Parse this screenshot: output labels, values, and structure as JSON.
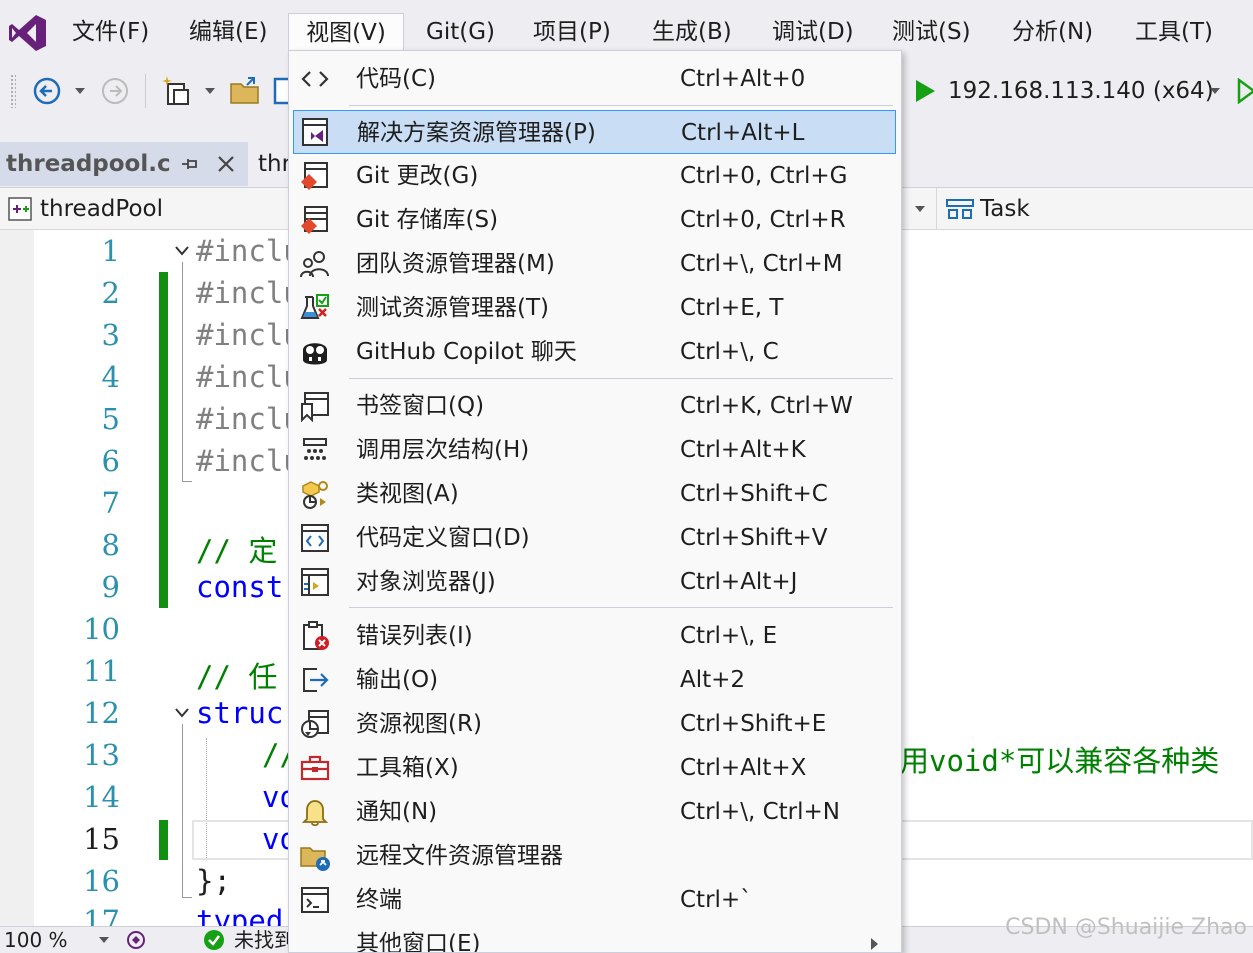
{
  "menubar": {
    "items": [
      "文件(F)",
      "编辑(E)",
      "视图(V)",
      "Git(G)",
      "项目(P)",
      "生成(B)",
      "调试(D)",
      "测试(S)",
      "分析(N)",
      "工具(T)"
    ]
  },
  "toolbar": {
    "debug_target": "192.168.113.140 (x64)"
  },
  "tabs": {
    "active": "threadpool.c",
    "second": "thr"
  },
  "navbar": {
    "scope": "threadPool",
    "member": "Task"
  },
  "editor": {
    "line_numbers": [
      "1",
      "2",
      "3",
      "4",
      "5",
      "6",
      "7",
      "8",
      "9",
      "10",
      "11",
      "12",
      "13",
      "14",
      "15",
      "16",
      "17"
    ],
    "lines": {
      "l1": "#inclu",
      "l2": "#inclu",
      "l3": "#inclu",
      "l4": "#inclu",
      "l5": "#inclu",
      "l6": "#inclu",
      "l8": "// 定",
      "l9": "const",
      "l11": "// 任",
      "l12": "struc",
      "l13": "//",
      "l13_right": "用void*可以兼容各种类",
      "l14": "vo",
      "l15": "vo",
      "l16": "};",
      "l17": "typed"
    }
  },
  "statusbar": {
    "zoom": "100 %",
    "status": "未找到"
  },
  "view_menu": {
    "items": [
      {
        "label": "代码(C)",
        "shortcut": "Ctrl+Alt+0",
        "icon": "code-icon"
      },
      {
        "label": "解决方案资源管理器(P)",
        "shortcut": "Ctrl+Alt+L",
        "icon": "solution-explorer-icon"
      },
      {
        "label": "Git 更改(G)",
        "shortcut": "Ctrl+0, Ctrl+G",
        "icon": "git-changes-icon"
      },
      {
        "label": "Git 存储库(S)",
        "shortcut": "Ctrl+0, Ctrl+R",
        "icon": "git-repository-icon"
      },
      {
        "label": "团队资源管理器(M)",
        "shortcut": "Ctrl+\\, Ctrl+M",
        "icon": "team-explorer-icon"
      },
      {
        "label": "测试资源管理器(T)",
        "shortcut": "Ctrl+E, T",
        "icon": "test-explorer-icon"
      },
      {
        "label": "GitHub Copilot 聊天",
        "shortcut": "Ctrl+\\, C",
        "icon": "copilot-icon"
      },
      {
        "label": "书签窗口(Q)",
        "shortcut": "Ctrl+K, Ctrl+W",
        "icon": "bookmark-icon"
      },
      {
        "label": "调用层次结构(H)",
        "shortcut": "Ctrl+Alt+K",
        "icon": "call-hierarchy-icon"
      },
      {
        "label": "类视图(A)",
        "shortcut": "Ctrl+Shift+C",
        "icon": "class-view-icon"
      },
      {
        "label": "代码定义窗口(D)",
        "shortcut": "Ctrl+Shift+V",
        "icon": "code-definition-icon"
      },
      {
        "label": "对象浏览器(J)",
        "shortcut": "Ctrl+Alt+J",
        "icon": "object-browser-icon"
      },
      {
        "label": "错误列表(I)",
        "shortcut": "Ctrl+\\, E",
        "icon": "error-list-icon"
      },
      {
        "label": "输出(O)",
        "shortcut": "Alt+2",
        "icon": "output-icon"
      },
      {
        "label": "资源视图(R)",
        "shortcut": "Ctrl+Shift+E",
        "icon": "resource-view-icon"
      },
      {
        "label": "工具箱(X)",
        "shortcut": "Ctrl+Alt+X",
        "icon": "toolbox-icon"
      },
      {
        "label": "通知(N)",
        "shortcut": "Ctrl+\\, Ctrl+N",
        "icon": "notification-bell-icon"
      },
      {
        "label": "远程文件资源管理器",
        "shortcut": "",
        "icon": "remote-file-explorer-icon"
      },
      {
        "label": "终端",
        "shortcut": "Ctrl+`",
        "icon": "terminal-icon"
      },
      {
        "label": "其他窗口(E)",
        "shortcut": "",
        "icon": "other-windows-icon"
      }
    ]
  },
  "watermark": "CSDN @Shuaijie Zhao",
  "colors": {
    "accent_purple": "#68217a",
    "highlight_bg": "#c9def5",
    "highlight_border": "#3399ff",
    "keyword_blue": "#0000ff",
    "comment_green": "#008000",
    "line_number": "#2b91af",
    "change_marker": "#108f10"
  }
}
